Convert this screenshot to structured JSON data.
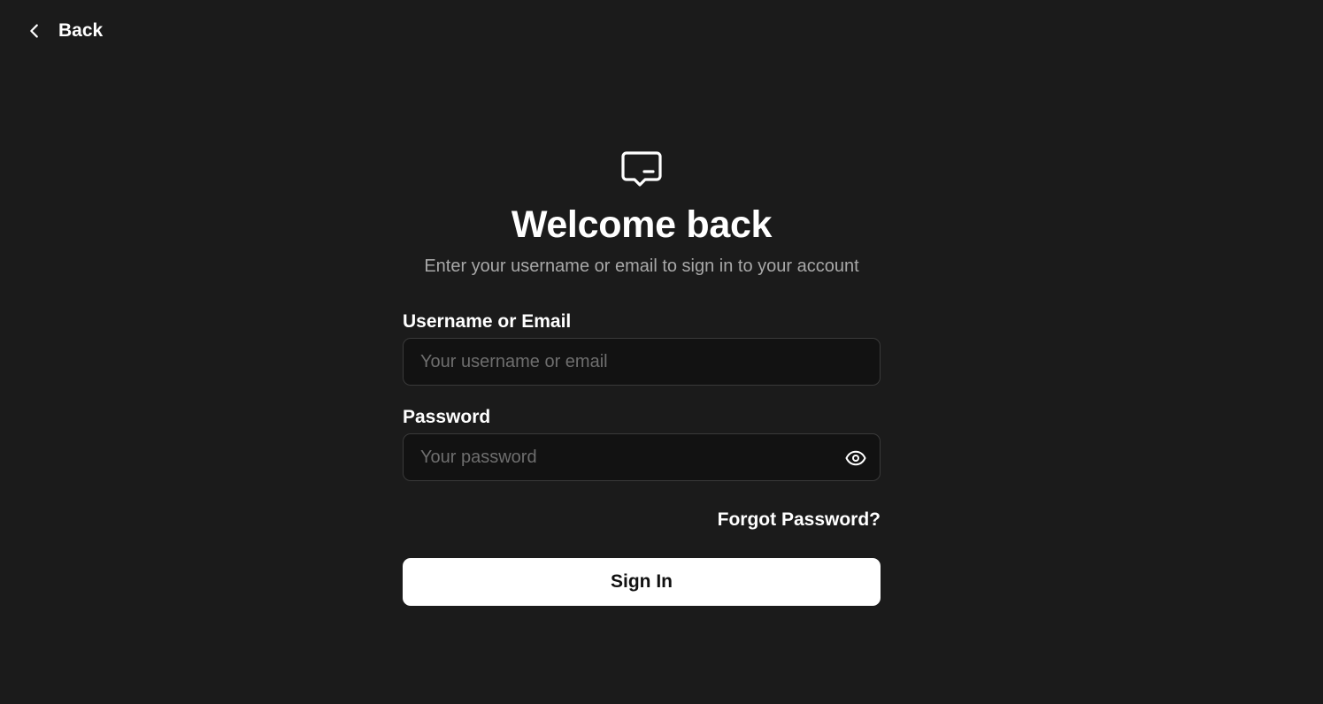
{
  "nav": {
    "back_label": "Back",
    "back_icon": "chevron-left-icon"
  },
  "header": {
    "brand_icon": "message-square-icon",
    "title": "Welcome back",
    "subtitle": "Enter your username or email to sign in to your account"
  },
  "form": {
    "username": {
      "label": "Username or Email",
      "value": "",
      "placeholder": "Your username or email"
    },
    "password": {
      "label": "Password",
      "value": "",
      "placeholder": "Your password",
      "toggle_icon": "eye-icon"
    },
    "forgot_label": "Forgot Password?",
    "submit_label": "Sign In"
  },
  "colors": {
    "background": "#1b1b1b",
    "input_background": "#121212",
    "input_border": "#3a3a3a",
    "text_primary": "#ffffff",
    "text_muted": "#a8a8a8",
    "placeholder": "#6e6e6e",
    "button_background": "#ffffff",
    "button_text": "#111111"
  }
}
